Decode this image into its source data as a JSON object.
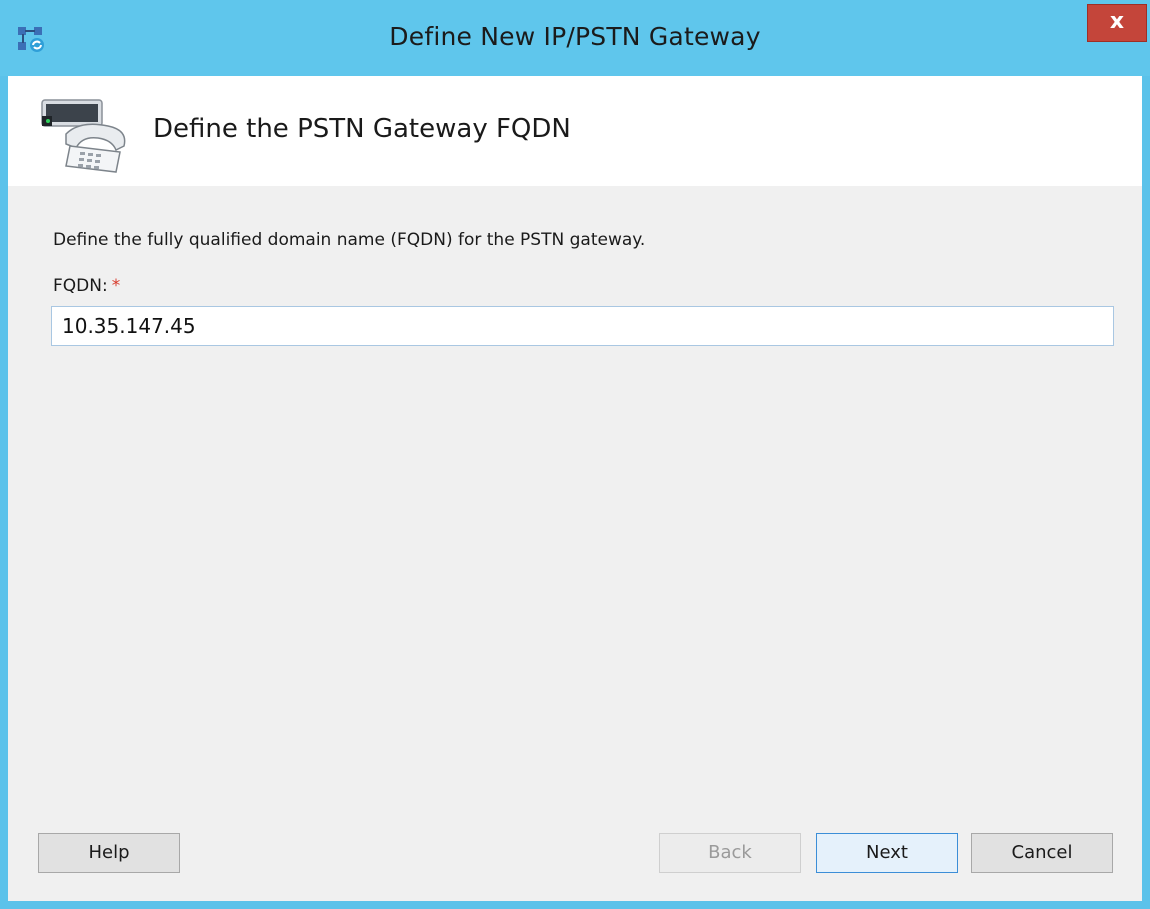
{
  "window": {
    "title": "Define New IP/PSTN Gateway",
    "close_label": "x"
  },
  "header": {
    "title": "Define the PSTN Gateway FQDN",
    "icon": "phone-gateway-icon"
  },
  "main": {
    "description": "Define the fully qualified domain name (FQDN) for the PSTN gateway.",
    "fqdn_label": "FQDN:",
    "required_marker": "*",
    "fqdn_value": "10.35.147.45"
  },
  "buttons": {
    "help": "Help",
    "back": "Back",
    "next": "Next",
    "cancel": "Cancel"
  },
  "colors": {
    "titlebar": "#5fc6ec",
    "close_button": "#c4453a",
    "required": "#d83a2b",
    "focus_border": "#3c8ed7"
  }
}
